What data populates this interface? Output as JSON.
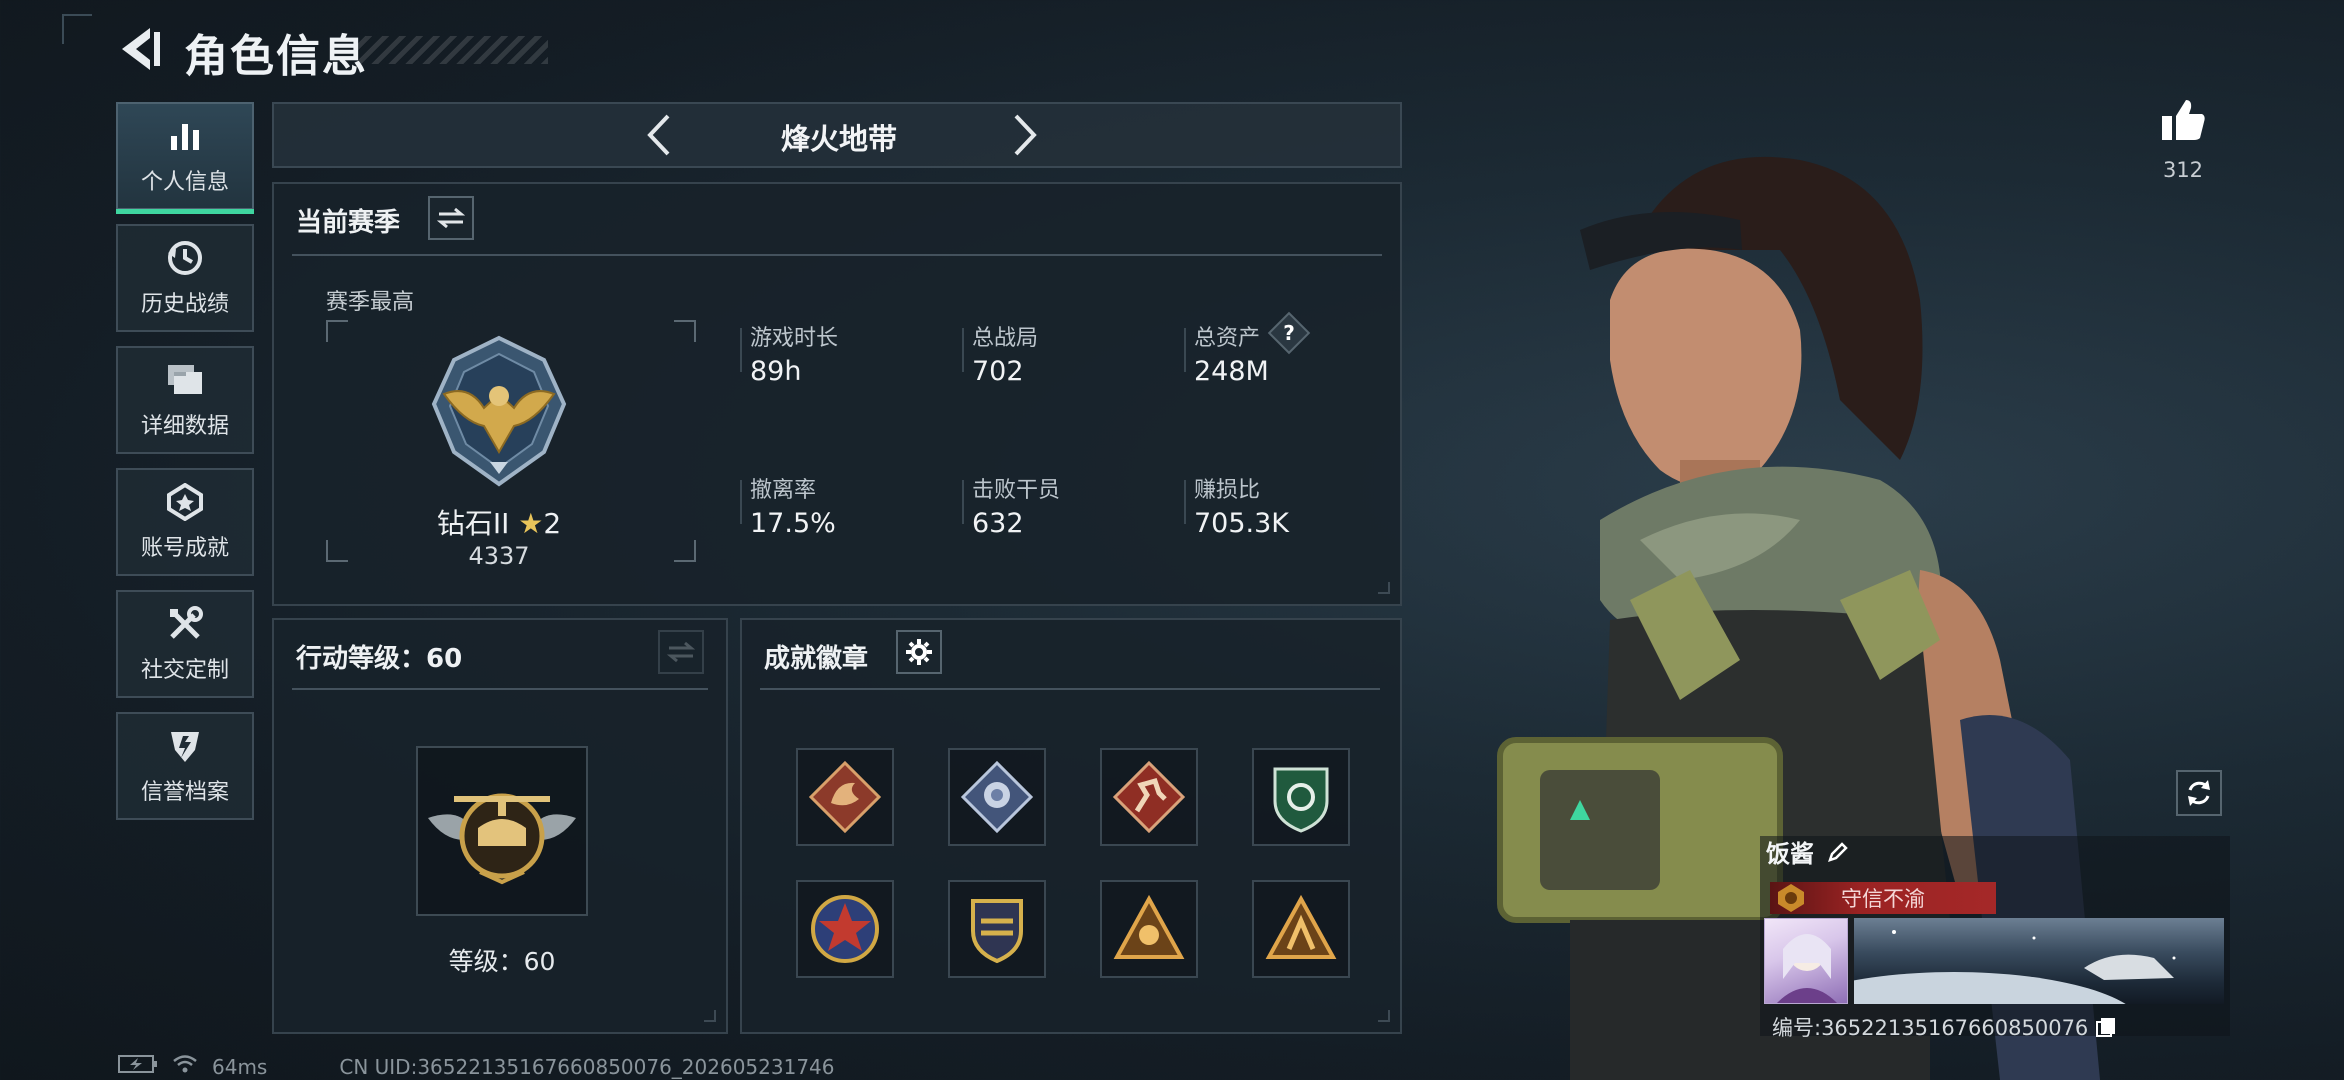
{
  "header": {
    "title": "角色信息"
  },
  "sidebar": {
    "items": [
      {
        "label": "个人信息",
        "icon": "bar-chart-icon",
        "active": true
      },
      {
        "label": "历史战绩",
        "icon": "history-clock-icon",
        "active": false
      },
      {
        "label": "详细数据",
        "icon": "folder-icon",
        "active": false
      },
      {
        "label": "账号成就",
        "icon": "achievement-medal-icon",
        "active": false
      },
      {
        "label": "社交定制",
        "icon": "tools-icon",
        "active": false
      },
      {
        "label": "信誉档案",
        "icon": "shield-credit-icon",
        "active": false
      }
    ]
  },
  "mode": {
    "title": "烽火地带"
  },
  "season": {
    "title": "当前赛季",
    "best_label": "赛季最高",
    "rank_name": "钻石II",
    "rank_stars": "2",
    "rank_points": "4337",
    "stats": [
      {
        "label": "游戏时长",
        "value": "89h"
      },
      {
        "label": "总战局",
        "value": "702"
      },
      {
        "label": "总资产",
        "value": "248M",
        "help": "?"
      },
      {
        "label": "撤离率",
        "value": "17.5%"
      },
      {
        "label": "击败干员",
        "value": "632"
      },
      {
        "label": "赚损比",
        "value": "705.3K"
      }
    ]
  },
  "action_level": {
    "title": "行动等级：60",
    "level_text": "等级：60"
  },
  "achievements": {
    "title": "成就徽章",
    "badges": [
      {
        "icon": "dragon-badge-icon",
        "color": "#b5503a"
      },
      {
        "icon": "rose-badge-icon",
        "color": "#6b7fa8"
      },
      {
        "icon": "runner-badge-icon",
        "color": "#b84a3a"
      },
      {
        "icon": "shield-badge-icon",
        "color": "#2f7a56"
      },
      {
        "icon": "star-badge-icon",
        "color": "#c0392b"
      },
      {
        "icon": "crest-badge-icon",
        "color": "#c9a227"
      },
      {
        "icon": "triangle-badge-icon",
        "color": "#c9892a"
      },
      {
        "icon": "triangle-badge-icon",
        "color": "#c9892a"
      }
    ]
  },
  "profile": {
    "likes": "312",
    "nickname": "饭酱",
    "title_tag": "守信不渝",
    "id_text": "编号:3652213516766085007​6"
  },
  "footer": {
    "ping": "64ms",
    "uid": "CN UID:36522135167660850076_202605231746"
  },
  "colors": {
    "accent": "#3fd6a0",
    "banner_red": "#a52828"
  }
}
